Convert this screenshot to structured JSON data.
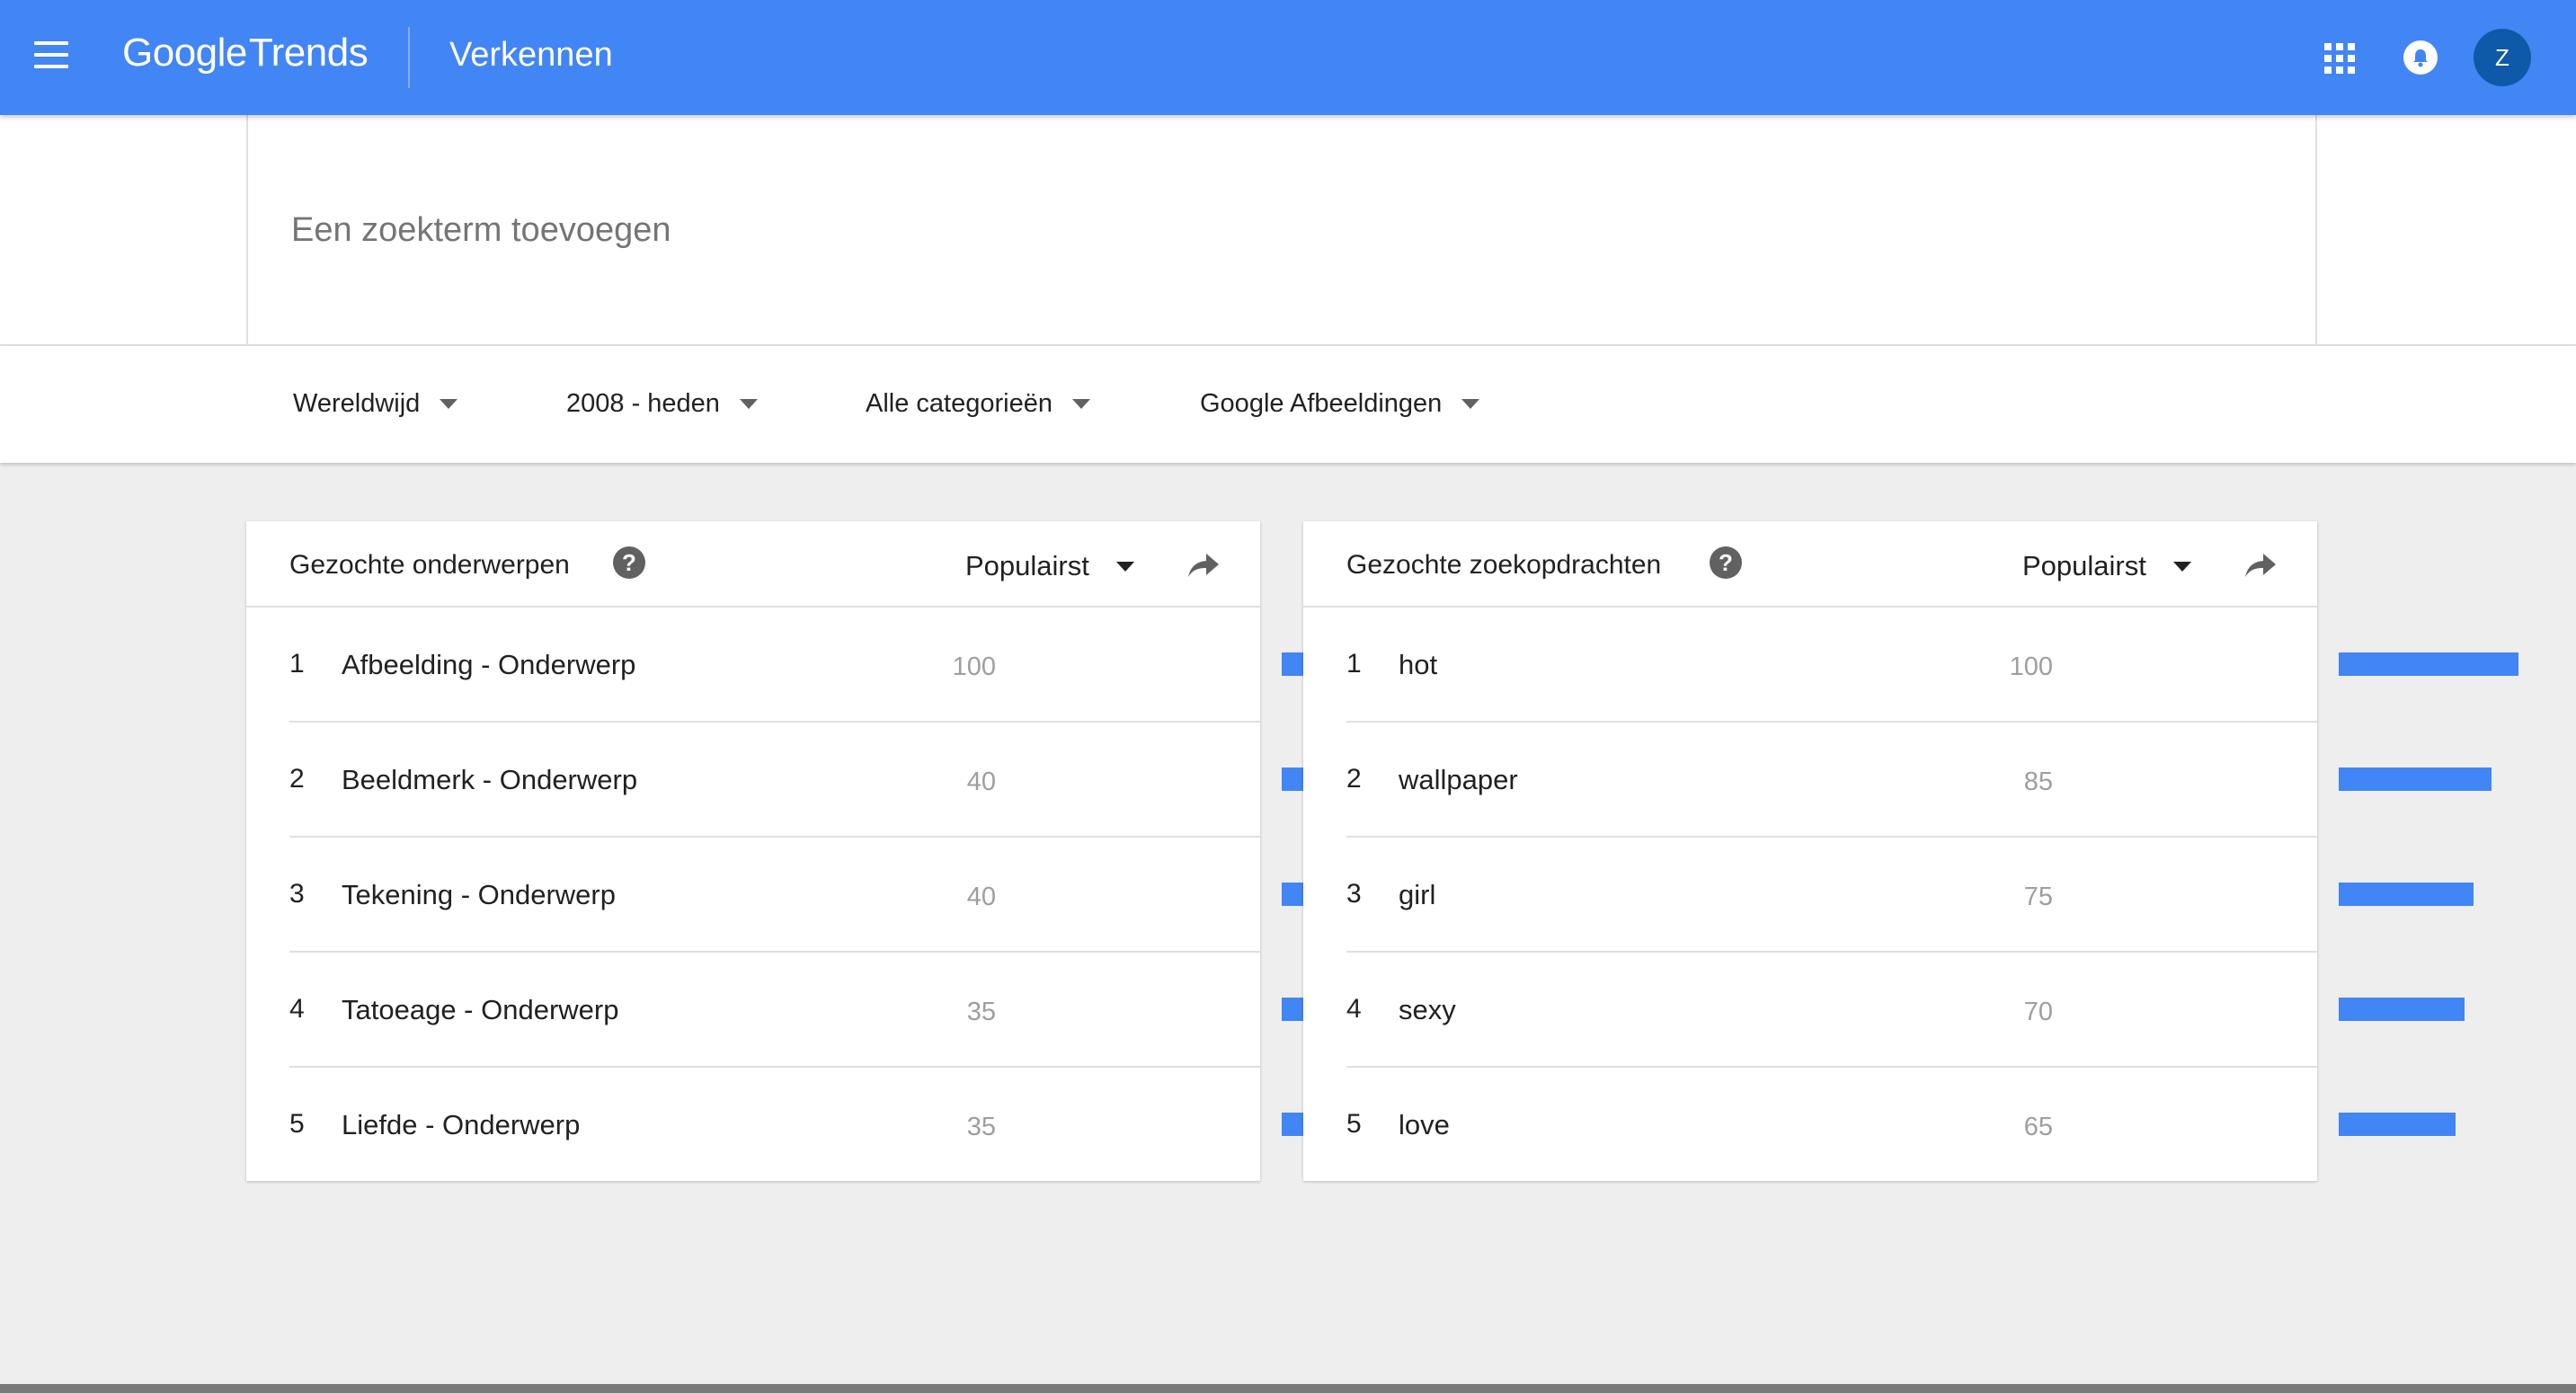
{
  "header": {
    "logo_google": "Google",
    "logo_trends": "Trends",
    "title": "Verkennen",
    "avatar_letter": "Z",
    "icons": {
      "menu": "menu-icon",
      "apps": "apps-grid-icon",
      "notifications": "bell-icon"
    }
  },
  "search": {
    "placeholder": "Een zoekterm toevoegen"
  },
  "filters": [
    {
      "label": "Wereldwijd"
    },
    {
      "label": "2008 - heden"
    },
    {
      "label": "Alle categorieën"
    },
    {
      "label": "Google Afbeeldingen"
    }
  ],
  "colors": {
    "brand": "#4285f4",
    "bar_track": "#eeeeee",
    "avatar": "#0f5aa8"
  },
  "cards": [
    {
      "title": "Gezochte onderwerpen",
      "sort": "Populairst",
      "rows": [
        {
          "rank": "1",
          "label": "Afbeelding - Onderwerp",
          "value": 100
        },
        {
          "rank": "2",
          "label": "Beeldmerk - Onderwerp",
          "value": 40
        },
        {
          "rank": "3",
          "label": "Tekening - Onderwerp",
          "value": 40
        },
        {
          "rank": "4",
          "label": "Tatoeage - Onderwerp",
          "value": 35
        },
        {
          "rank": "5",
          "label": "Liefde - Onderwerp",
          "value": 35
        }
      ]
    },
    {
      "title": "Gezochte zoekopdrachten",
      "sort": "Populairst",
      "rows": [
        {
          "rank": "1",
          "label": "hot",
          "value": 100
        },
        {
          "rank": "2",
          "label": "wallpaper",
          "value": 85
        },
        {
          "rank": "3",
          "label": "girl",
          "value": 75
        },
        {
          "rank": "4",
          "label": "sexy",
          "value": 70
        },
        {
          "rank": "5",
          "label": "love",
          "value": 65
        }
      ]
    }
  ]
}
